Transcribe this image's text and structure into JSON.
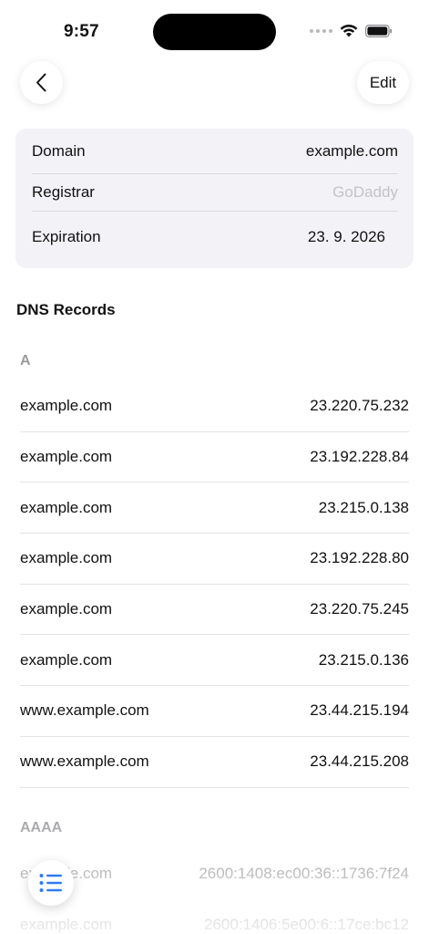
{
  "status_bar": {
    "time": "9:57"
  },
  "nav": {
    "edit_label": "Edit"
  },
  "info": [
    {
      "label": "Domain",
      "value": "example.com"
    },
    {
      "label": "Registrar",
      "value": "GoDaddy"
    },
    {
      "label": "Expiration",
      "value": "23. 9. 2026"
    }
  ],
  "dns": {
    "title": "DNS Records",
    "a_header": "A",
    "a_records": [
      {
        "host": "example.com",
        "address": "23.220.75.232"
      },
      {
        "host": "example.com",
        "address": "23.192.228.84"
      },
      {
        "host": "example.com",
        "address": "23.215.0.138"
      },
      {
        "host": "example.com",
        "address": "23.192.228.80"
      },
      {
        "host": "example.com",
        "address": "23.220.75.245"
      },
      {
        "host": "example.com",
        "address": "23.215.0.136"
      },
      {
        "host": "www.example.com",
        "address": "23.44.215.194"
      },
      {
        "host": "www.example.com",
        "address": "23.44.215.208"
      }
    ],
    "aaaa_header": "AAAA",
    "aaaa_records": [
      {
        "host": "example.com",
        "address": "2600:1408:ec00:36::1736:7f24"
      },
      {
        "host": "example.com",
        "address": "2600:1406:5e00:6::17ce:bc12"
      }
    ]
  },
  "icons": {
    "back": "chevron-left-icon",
    "list": "list-icon",
    "wifi": "wifi-icon",
    "battery": "battery-icon"
  },
  "colors": {
    "accent": "#2f7cf6",
    "card": "#f2f2f7",
    "muted": "#c4c4c8"
  }
}
